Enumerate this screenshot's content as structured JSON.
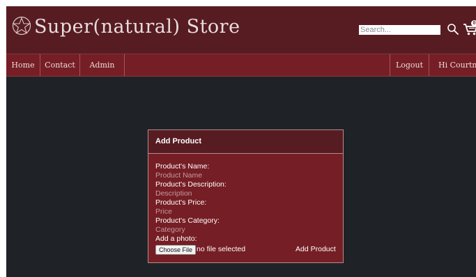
{
  "header": {
    "site_title": "Super(natural) Store",
    "search_placeholder": "Search...",
    "cart_count": "0",
    "icons": [
      "pentagram-logo-icon",
      "search-icon",
      "cart-icon"
    ]
  },
  "nav": {
    "home": "Home",
    "contact": "Contact",
    "admin": "Admin",
    "logout": "Logout",
    "greeting": "Hi Courtney"
  },
  "form": {
    "title": "Add Product",
    "name_label": "Product's Name:",
    "name_placeholder": "Product Name",
    "description_label": "Product's Description:",
    "description_placeholder": "Description",
    "price_label": "Product's Price:",
    "price_placeholder": "Price",
    "category_label": "Product's Category:",
    "category_placeholder": "Category",
    "photo_label": "Add a photo:",
    "choose_file_label": "Choose File",
    "file_status": "no file selected",
    "submit_label": "Add Product"
  },
  "colors": {
    "header_bg": "#571c22",
    "nav_bg": "#761e25",
    "page_bg": "#1f2327",
    "card_bg": "#761e25",
    "text_light": "#ffffff",
    "placeholder_text": "#c49a9e"
  }
}
